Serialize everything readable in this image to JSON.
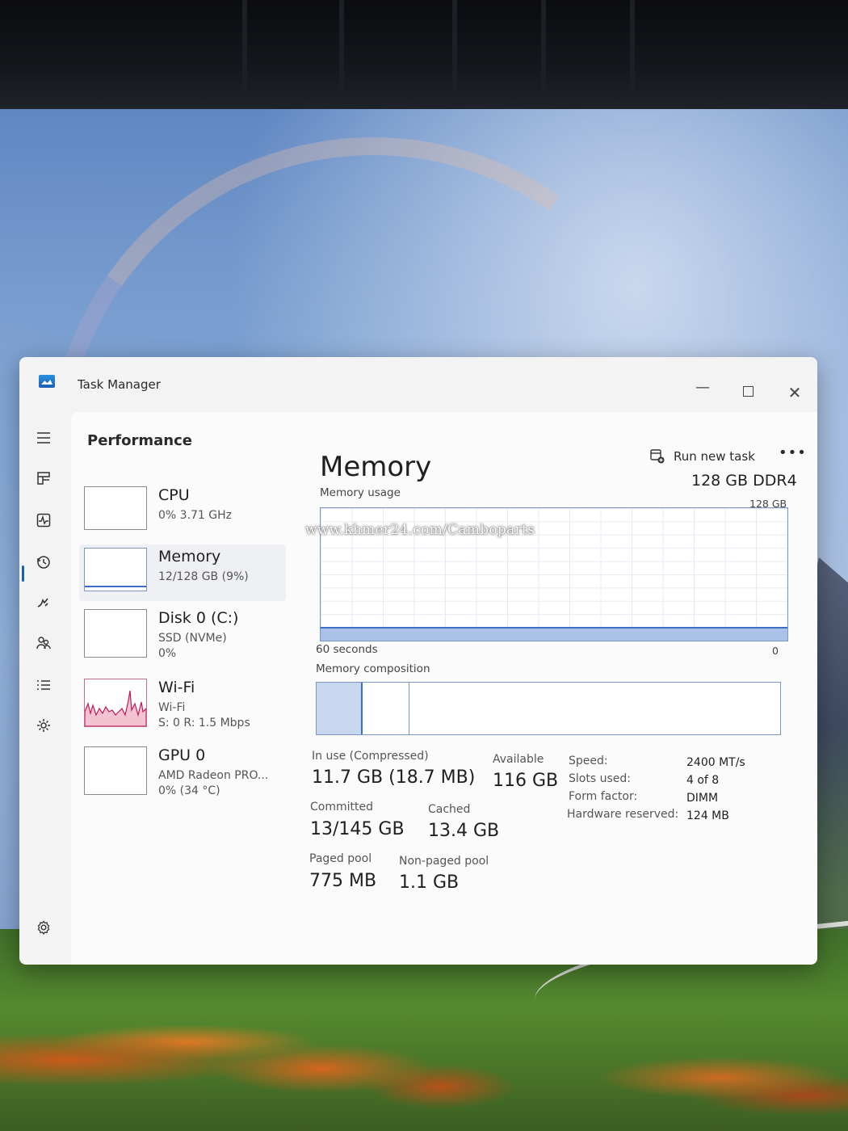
{
  "window": {
    "title": "Task Manager"
  },
  "header": {
    "page_title": "Performance",
    "run_new_task": "Run new task",
    "more": "•••"
  },
  "rail": {
    "items": [
      "hamburger-icon",
      "processes-icon",
      "performance-icon",
      "app-history-icon",
      "startup-apps-icon",
      "users-icon",
      "details-icon",
      "services-icon",
      "settings-icon"
    ]
  },
  "devices": [
    {
      "name": "CPU",
      "line1": "0% 3.71 GHz"
    },
    {
      "name": "Memory",
      "line1": "12/128 GB (9%)"
    },
    {
      "name": "Disk 0 (C:)",
      "line1": "SSD (NVMe)",
      "line2": "0%"
    },
    {
      "name": "Wi-Fi",
      "line1": "Wi-Fi",
      "line2": "S: 0 R: 1.5 Mbps"
    },
    {
      "name": "GPU 0",
      "line1": "AMD Radeon PRO...",
      "line2": "0% (34 °C)"
    }
  ],
  "memory": {
    "title": "Memory",
    "spec": "128 GB DDR4",
    "usage_label": "Memory usage",
    "usage_max": "128 GB",
    "usage_fraction": 0.09,
    "time_span": "60 seconds",
    "usage_min": "0",
    "composition_label": "Memory composition",
    "in_use_label": "In use (Compressed)",
    "in_use_value": "11.7 GB (18.7 MB)",
    "available_label": "Available",
    "available_value": "116 GB",
    "committed_label": "Committed",
    "committed_value": "13/145 GB",
    "cached_label": "Cached",
    "cached_value": "13.4 GB",
    "paged_label": "Paged pool",
    "paged_value": "775 MB",
    "nonpaged_label": "Non-paged pool",
    "nonpaged_value": "1.1 GB",
    "details": [
      {
        "k": "Speed:",
        "v": "2400 MT/s"
      },
      {
        "k": "Slots used:",
        "v": "4 of 8"
      },
      {
        "k": "Form factor:",
        "v": "DIMM"
      },
      {
        "k": "Hardware reserved:",
        "v": "124 MB"
      }
    ]
  },
  "watermark": "www.khmer24.com/Camboparts",
  "colors": {
    "accent": "#3a6fc4",
    "graph_fill": "#aac2e8",
    "wifi_line": "#c2185b"
  }
}
